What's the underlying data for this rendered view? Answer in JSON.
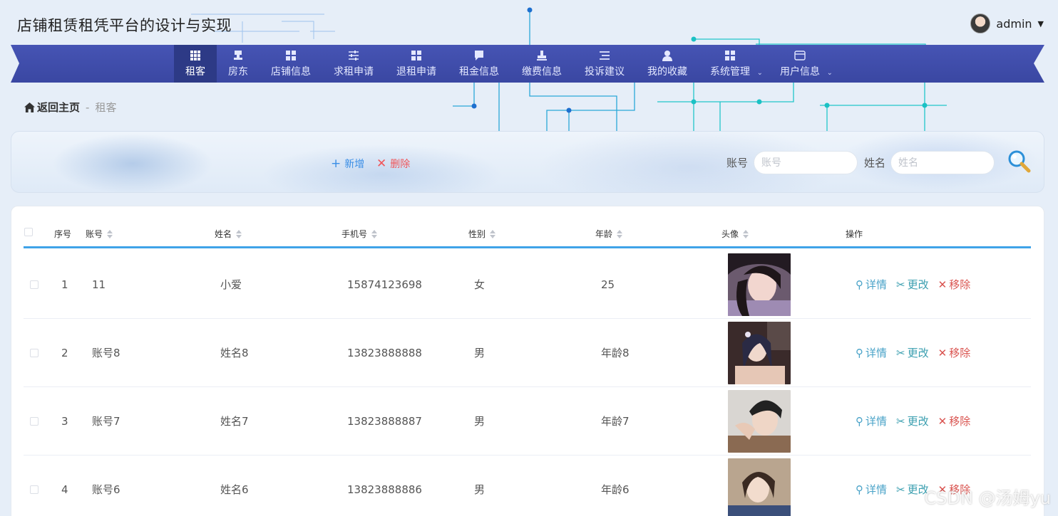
{
  "app": {
    "title": "店铺租赁租凭平台的设计与实现"
  },
  "user": {
    "name": "admin"
  },
  "nav": [
    {
      "label": "租客",
      "active": true,
      "icon": "grid-icon"
    },
    {
      "label": "房东",
      "icon": "stamp-icon"
    },
    {
      "label": "店铺信息",
      "icon": "grid-icon"
    },
    {
      "label": "求租申请",
      "icon": "sliders-icon"
    },
    {
      "label": "退租申请",
      "icon": "grid-icon"
    },
    {
      "label": "租金信息",
      "icon": "chat-icon"
    },
    {
      "label": "缴费信息",
      "icon": "stamp-icon"
    },
    {
      "label": "投诉建议",
      "icon": "list-icon"
    },
    {
      "label": "我的收藏",
      "icon": "user-icon"
    },
    {
      "label": "系统管理",
      "icon": "grid-icon",
      "has_sub": true
    },
    {
      "label": "用户信息",
      "icon": "card-icon",
      "has_sub": true
    }
  ],
  "breadcrumb": {
    "home": "返回主页",
    "sep": "-",
    "current": "租客"
  },
  "toolbar": {
    "add_label": "新增",
    "delete_label": "删除",
    "account_label": "账号",
    "account_placeholder": "账号",
    "name_label": "姓名",
    "name_placeholder": "姓名"
  },
  "table": {
    "headers": {
      "index": "序号",
      "account": "账号",
      "name": "姓名",
      "phone": "手机号",
      "gender": "性别",
      "age": "年龄",
      "avatar": "头像",
      "actions": "操作"
    },
    "action_labels": {
      "detail": "详情",
      "edit": "更改",
      "remove": "移除"
    },
    "rows": [
      {
        "index": "1",
        "account": "11",
        "name": "小爱",
        "phone": "15874123698",
        "gender": "女",
        "age": "25"
      },
      {
        "index": "2",
        "account": "账号8",
        "name": "姓名8",
        "phone": "13823888888",
        "gender": "男",
        "age": "年龄8"
      },
      {
        "index": "3",
        "account": "账号7",
        "name": "姓名7",
        "phone": "13823888887",
        "gender": "男",
        "age": "年龄7"
      },
      {
        "index": "4",
        "account": "账号6",
        "name": "姓名6",
        "phone": "13823888886",
        "gender": "男",
        "age": "年龄6"
      }
    ]
  },
  "watermark": "CSDN @汤姆yu",
  "colors": {
    "nav_bg": "#3b4aa8",
    "nav_active": "#2d3a86",
    "accent_blue": "#3fa3e8",
    "danger": "#f0565a"
  }
}
